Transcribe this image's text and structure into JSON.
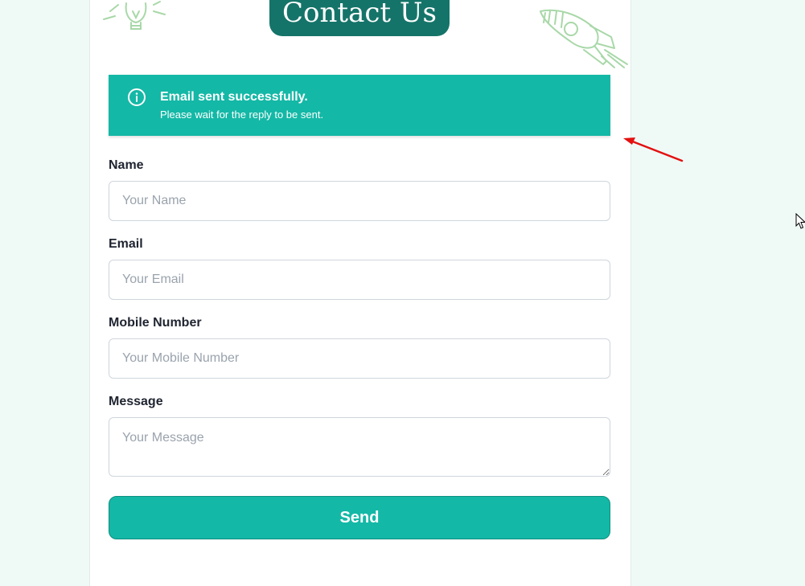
{
  "header": {
    "title": "Contact Us"
  },
  "alert": {
    "icon": "info-icon",
    "title": "Email sent successfully.",
    "message": "Please wait for the reply to be sent."
  },
  "form": {
    "name": {
      "label": "Name",
      "placeholder": "Your Name",
      "value": ""
    },
    "email": {
      "label": "Email",
      "placeholder": "Your Email",
      "value": ""
    },
    "mobile": {
      "label": "Mobile Number",
      "placeholder": "Your Mobile Number",
      "value": ""
    },
    "message": {
      "label": "Message",
      "placeholder": "Your Message",
      "value": ""
    },
    "submit_label": "Send"
  },
  "colors": {
    "accent": "#14b8a6",
    "title_tab": "#157469",
    "page_background": "#effaf7",
    "annotation_arrow": "#e31010"
  },
  "decorations": [
    "lightbulb-doodle-icon",
    "rocket-doodle-icon"
  ]
}
